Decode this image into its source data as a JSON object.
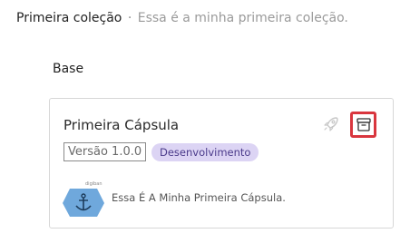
{
  "header": {
    "title": "Primeira coleção",
    "separator": "·",
    "description": "Essa é a minha primeira coleção."
  },
  "section": {
    "title": "Base"
  },
  "card": {
    "title": "Primeira Cápsula",
    "version": "Versão 1.0.0",
    "status_badge": "Desenvolvimento",
    "description": "Essa É A Minha Primeira Cápsula.",
    "logo_brand": "digiban",
    "rocket_icon": "rocket-icon",
    "archive_icon": "archive-icon",
    "archive_highlight_color": "#d9363e",
    "badge_color": "#dcd4f4",
    "logo_color": "#6fa8dc"
  }
}
